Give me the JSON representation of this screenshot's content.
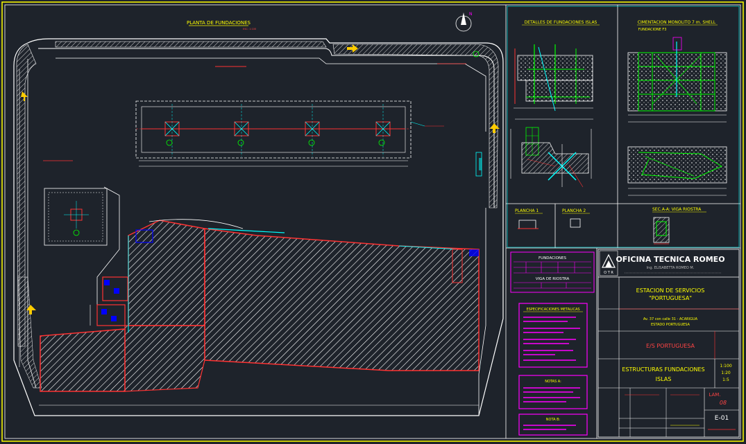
{
  "plan": {
    "title": "PLANTA DE FUNDACIONES",
    "scale": "ESC: 1:100"
  },
  "details": {
    "islands_title": "DETALLES DE FUNDACIONES ISLAS",
    "monolith_title": "CIMENTACION MONOLITO 7 m. SHELL",
    "monolith_sub": "FUNDACIONE F3",
    "plancha1": "PLANCHA 1",
    "plancha2": "PLANCHA 2",
    "section": "SEC.A-A: VIGA RIOSTRA"
  },
  "tables": {
    "fundaciones": "FUNDACIONES",
    "viga": "VIGA DE RIOSTRA",
    "specs": "ESPECIFICACIONES METALICAS",
    "notas_a": "NOTAS A:",
    "nota_b": "NOTA B:"
  },
  "title_block": {
    "office": "OFICINA TECNICA ROMEO",
    "engineer": "Ing. ELISABETTA ROMEO M.",
    "logo": "O T R",
    "project_line1": "ESTACION DE SERVICIOS",
    "project_line2": "\"PORTUGUESA\"",
    "address1": "Av. 37 con calle 31 - ACARIGUA",
    "address2": "ESTADO PORTUGUESA",
    "owner": "E/S PORTUGUESA",
    "content1": "ESTRUCTURAS FUNDACIONES",
    "content2": "ISLAS",
    "scale1": "1:100",
    "scale2": "1:20",
    "scale3": "1:5",
    "lam_label": "LAM.",
    "lam_value": "08",
    "sheet": "E-01"
  }
}
